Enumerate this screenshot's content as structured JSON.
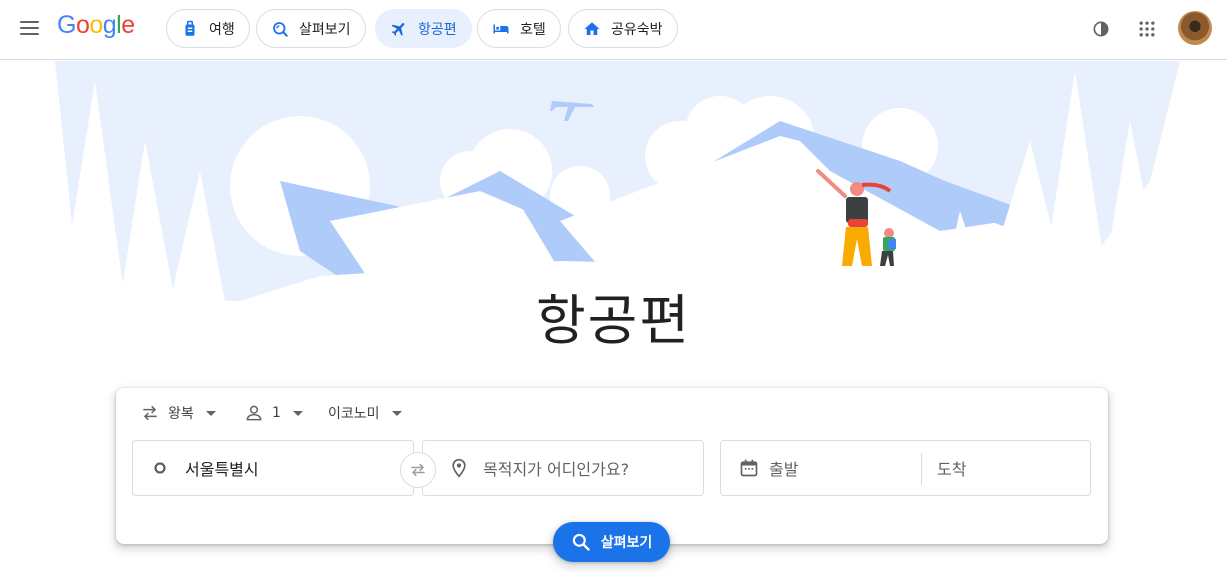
{
  "header": {
    "logo": [
      "G",
      "o",
      "o",
      "g",
      "l",
      "e"
    ],
    "chips": [
      {
        "label": "여행",
        "icon": "luggage-icon"
      },
      {
        "label": "살펴보기",
        "icon": "explore-icon"
      },
      {
        "label": "항공편",
        "icon": "flight-icon",
        "active": true
      },
      {
        "label": "호텔",
        "icon": "hotel-icon"
      },
      {
        "label": "공유숙박",
        "icon": "home-icon"
      }
    ],
    "icons": [
      "dark-mode-icon",
      "apps-grid-icon",
      "avatar"
    ]
  },
  "hero": {
    "title": "항공편"
  },
  "search": {
    "trip_type": "왕복",
    "passengers": "1",
    "cabin_class": "이코노미",
    "origin": "서울특별시",
    "destination_placeholder": "목적지가 어디인가요?",
    "departure_placeholder": "출발",
    "return_placeholder": "도착",
    "search_button": "살펴보기"
  },
  "colors": {
    "accent": "#1a73e8",
    "active_chip_bg": "#e8f0fe",
    "active_chip_text": "#1967d2",
    "hero_sky": "#e8f0fe",
    "hero_mountain": "#aecbfa"
  }
}
